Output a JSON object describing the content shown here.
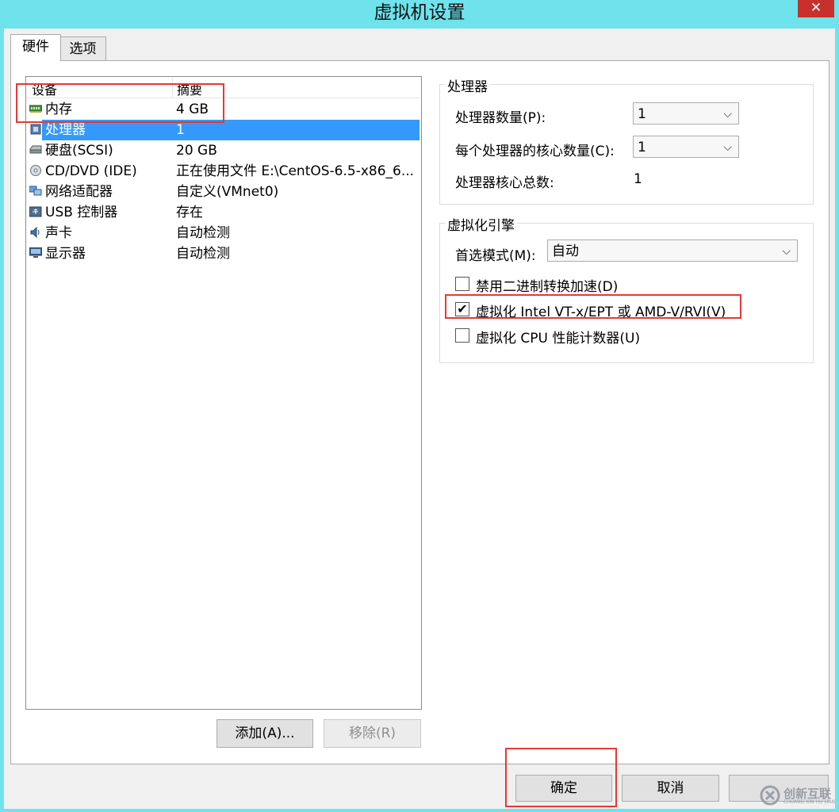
{
  "window": {
    "title": "虚拟机设置",
    "close_glyph": "✕"
  },
  "tabs": [
    {
      "label": "硬件"
    },
    {
      "label": "选项"
    }
  ],
  "device_list": {
    "headers": {
      "device": "设备",
      "summary": "摘要"
    },
    "rows": [
      {
        "label": "内存",
        "summary": "4 GB",
        "icon": "memory-icon"
      },
      {
        "label": "处理器",
        "summary": "1",
        "icon": "processor-icon",
        "selected": true
      },
      {
        "label": "硬盘(SCSI)",
        "summary": "20 GB",
        "icon": "harddisk-icon"
      },
      {
        "label": "CD/DVD (IDE)",
        "summary": "正在使用文件 E:\\CentOS-6.5-x86_6...",
        "icon": "cdrom-icon"
      },
      {
        "label": "网络适配器",
        "summary": "自定义(VMnet0)",
        "icon": "network-adapter-icon"
      },
      {
        "label": "USB 控制器",
        "summary": "存在",
        "icon": "usb-icon"
      },
      {
        "label": "声卡",
        "summary": "自动检测",
        "icon": "sound-card-icon"
      },
      {
        "label": "显示器",
        "summary": "自动检测",
        "icon": "display-icon"
      }
    ],
    "add_button": "添加(A)...",
    "remove_button": "移除(R)"
  },
  "processor": {
    "group_title": "处理器",
    "count_label": "处理器数量(P):",
    "count_value": "1",
    "cores_label": "每个处理器的核心数量(C):",
    "cores_value": "1",
    "total_label": "处理器核心总数:",
    "total_value": "1"
  },
  "virtualization": {
    "group_title": "虚拟化引擎",
    "mode_label": "首选模式(M):",
    "mode_value": "自动",
    "options": [
      {
        "label": "禁用二进制转换加速(D)",
        "checked": false
      },
      {
        "label": "虚拟化 Intel VT-x/EPT 或 AMD-V/RVI(V)",
        "checked": true
      },
      {
        "label": "虚拟化 CPU 性能计数器(U)",
        "checked": false
      }
    ]
  },
  "footer": {
    "ok": "确定",
    "cancel": "取消",
    "help": ""
  },
  "watermark": {
    "text": "创新互联",
    "subtext": "CHUANG XIN HU LIAN"
  },
  "colors": {
    "selection": "#3399ff",
    "highlight_box": "#e53935",
    "title_bar": "#6fe3ec"
  }
}
